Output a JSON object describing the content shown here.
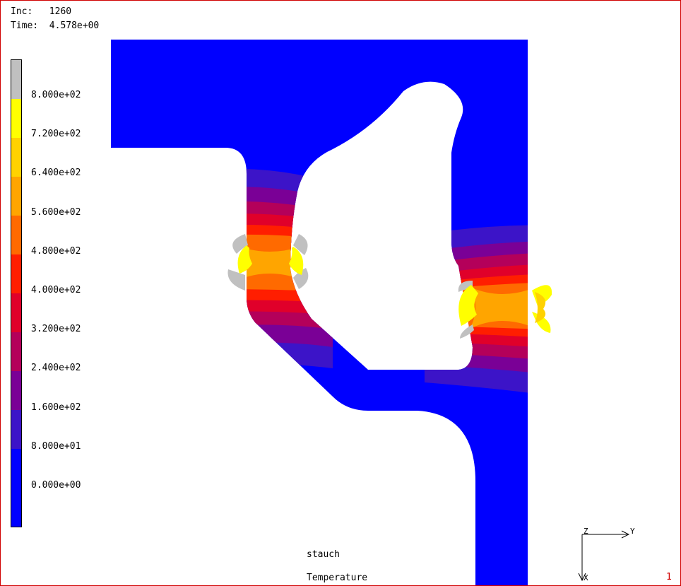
{
  "header": {
    "inc_label": "Inc:",
    "inc_value": "1260",
    "time_label": "Time:",
    "time_value": "4.578e+00"
  },
  "legend": {
    "labels": [
      "8.000e+02",
      "7.200e+02",
      "6.400e+02",
      "5.600e+02",
      "4.800e+02",
      "4.000e+02",
      "3.200e+02",
      "2.400e+02",
      "1.600e+02",
      "8.000e+01",
      "0.000e+00"
    ],
    "colors_top_to_bottom": [
      "#c0c0c0",
      "#ffff00",
      "#ffd200",
      "#ffa500",
      "#ff6a00",
      "#ff1e00",
      "#e0002a",
      "#b4005a",
      "#7a0096",
      "#3c14c8",
      "#0000ff",
      "#0000ff"
    ]
  },
  "footer": {
    "model_name": "stauch",
    "variable": "Temperature",
    "page_number": "1"
  },
  "axes_triad": {
    "z_label": "Z",
    "y_label": "Y",
    "x_label": "X"
  },
  "colors": {
    "frame": "#d00000",
    "part_base": "#0000ff"
  }
}
